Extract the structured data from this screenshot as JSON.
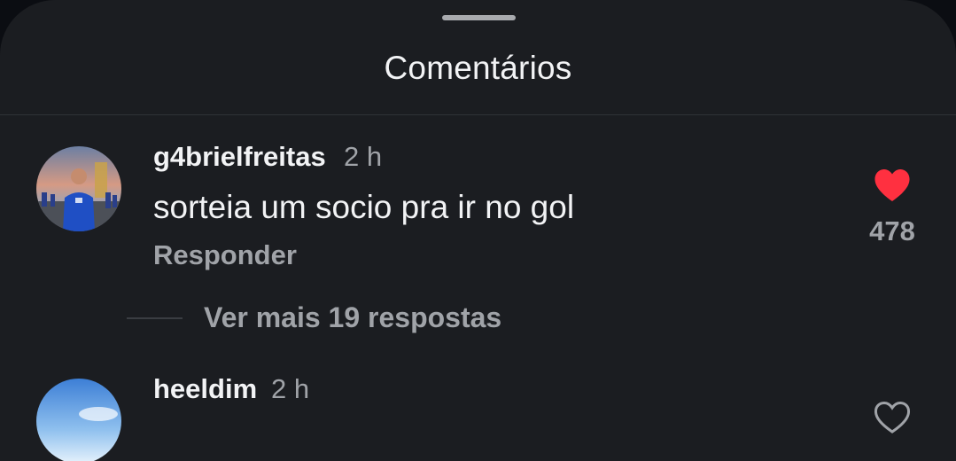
{
  "sheet": {
    "title": "Comentários"
  },
  "comments": [
    {
      "username": "g4brielfreitas",
      "time": "2 h",
      "text": "sorteia um socio pra ir no gol",
      "reply_label": "Responder",
      "likes": "478",
      "liked": true,
      "more_replies_label": "Ver mais 19 respostas"
    },
    {
      "username": "heeldim",
      "time": "2 h"
    }
  ],
  "colors": {
    "like_active": "#ff3040",
    "background": "#1b1d21"
  }
}
